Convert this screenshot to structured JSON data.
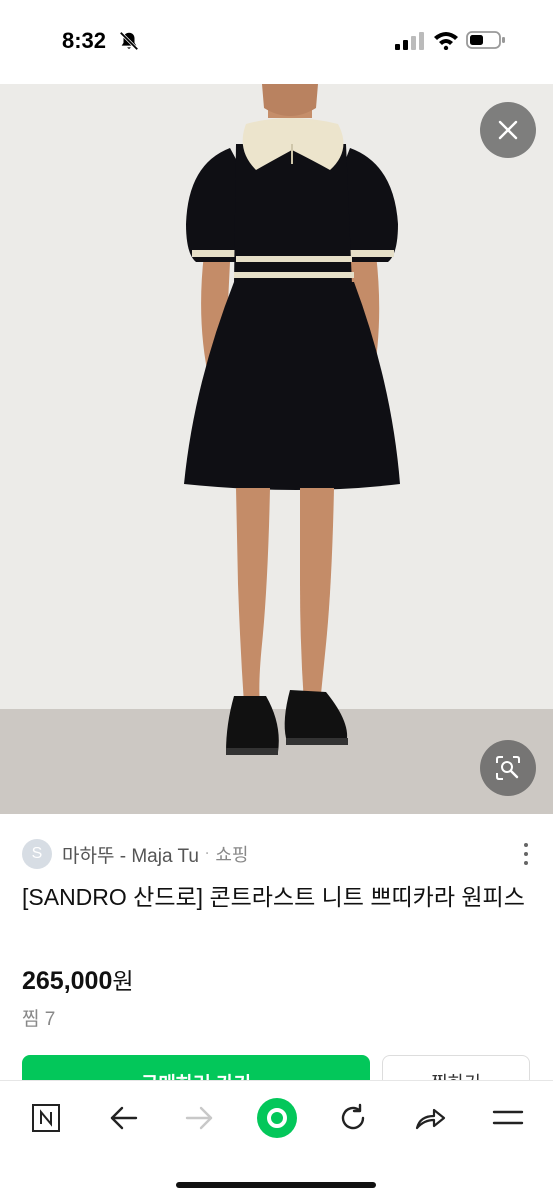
{
  "status_bar": {
    "time": "8:32"
  },
  "product_image": {
    "close_icon": "close-icon",
    "lens_icon": "image-search-icon"
  },
  "seller": {
    "avatar_initial": "S",
    "name": "마하뚜 - Maja Tu",
    "separator": "·",
    "category": "쇼핑"
  },
  "product": {
    "title": "[SANDRO 산드로] 콘트라스트 니트 쁘띠카라 원피스",
    "price": "265,000",
    "currency": "원",
    "wish_count": "찜 7"
  },
  "actions": {
    "buy_label": "구매하러 가기",
    "wish_label": "찜하기"
  },
  "toolbar": {
    "items": [
      "naver-home-icon",
      "back-arrow-icon",
      "forward-arrow-icon",
      "green-dot-icon",
      "refresh-icon",
      "share-icon",
      "menu-icon"
    ]
  },
  "colors": {
    "brand_green": "#03c75a"
  }
}
